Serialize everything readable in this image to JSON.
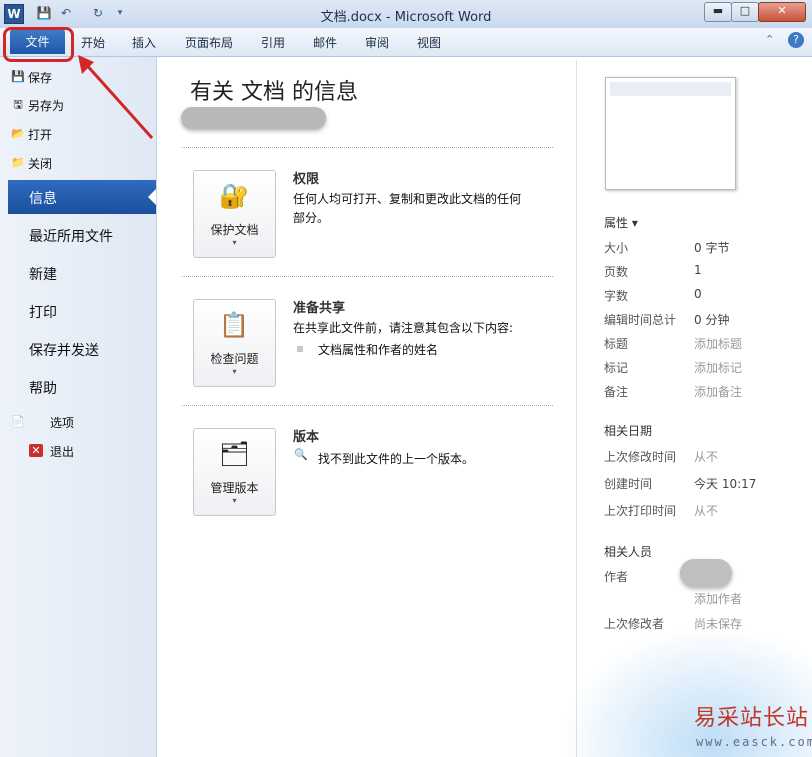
{
  "window": {
    "title": "文档.docx - Microsoft Word",
    "app_icon_letter": "W",
    "minimize": "▬",
    "maximize": "□",
    "close": "✕"
  },
  "ribbon_tabs": [
    "文件",
    "开始",
    "插入",
    "页面布局",
    "引用",
    "邮件",
    "审阅",
    "视图"
  ],
  "sidebar": {
    "small_items": [
      {
        "label": "保存",
        "icon": "save-icon"
      },
      {
        "label": "另存为",
        "icon": "save-as-icon"
      },
      {
        "label": "打开",
        "icon": "open-folder-icon"
      },
      {
        "label": "关闭",
        "icon": "close-folder-icon"
      }
    ],
    "big_items": [
      "信息",
      "最近所用文件",
      "新建",
      "打印",
      "保存并发送",
      "帮助"
    ],
    "bottom_items": [
      {
        "label": "选项",
        "icon": "options-icon"
      },
      {
        "label": "退出",
        "icon": "exit-icon"
      }
    ],
    "selected": "信息"
  },
  "main": {
    "title": "有关 文档 的信息",
    "sections": [
      {
        "button_label": "保护文档",
        "title": "权限",
        "lines": [
          "任何人均可打开、复制和更改此文档的任何",
          "部分。"
        ],
        "icon": "lock-key-icon"
      },
      {
        "button_label": "检查问题",
        "title": "准备共享",
        "lines": [
          "在共享此文件前，请注意其包含以下内容:"
        ],
        "bullet": "文档属性和作者的姓名",
        "icon": "checklist-icon"
      },
      {
        "button_label": "管理版本",
        "title": "版本",
        "lines": [
          "找不到此文件的上一个版本。"
        ],
        "icon": "versions-icon"
      }
    ]
  },
  "properties": {
    "header": "属性 ▾",
    "rows": [
      {
        "key": "大小",
        "value": "0 字节",
        "muted": false
      },
      {
        "key": "页数",
        "value": "1",
        "muted": false
      },
      {
        "key": "字数",
        "value": "0",
        "muted": false
      },
      {
        "key": "编辑时间总计",
        "value": "0 分钟",
        "muted": false
      },
      {
        "key": "标题",
        "value": "添加标题",
        "muted": true
      },
      {
        "key": "标记",
        "value": "添加标记",
        "muted": true
      },
      {
        "key": "备注",
        "value": "添加备注",
        "muted": true
      }
    ],
    "dates_header": "相关日期",
    "dates": [
      {
        "key": "上次修改时间",
        "value": "从不",
        "muted": true
      },
      {
        "key": "创建时间",
        "value": "今天 10:17",
        "muted": false
      },
      {
        "key": "上次打印时间",
        "value": "从不",
        "muted": true
      }
    ],
    "people_header": "相关人员",
    "author_label": "作者",
    "add_author": "添加作者",
    "last_modified_by_label": "上次修改者",
    "last_modified_by_value": "尚未保存"
  },
  "watermark": {
    "name": "易采站长站",
    "url": "www.easck.com"
  },
  "colors": {
    "file_tab": "#1e56a8",
    "highlight": "#d32626",
    "watermark": "#c0392b"
  }
}
